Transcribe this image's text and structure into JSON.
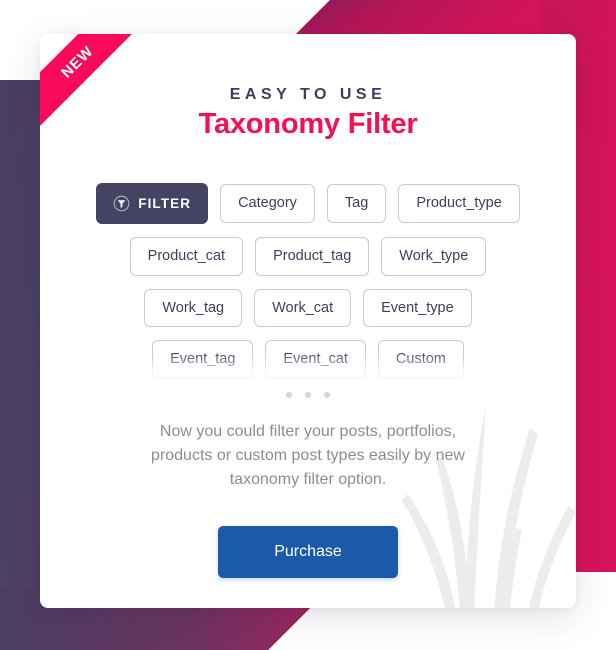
{
  "card": {
    "ribbon_label": "NEW",
    "eyebrow": "EASY TO USE",
    "title": "Taxonomy Filter",
    "description": "Now you could filter your posts, portfolios, products or custom post types easily by new taxonomy filter option.",
    "purchase_label": "Purchase"
  },
  "filter_button": {
    "label": "FILTER",
    "icon": "funnel-icon"
  },
  "tag_rows": [
    [
      "Category",
      "Tag",
      "Product_type"
    ],
    [
      "Product_cat",
      "Product_tag",
      "Work_type"
    ],
    [
      "Work_tag",
      "Work_cat",
      "Event_type"
    ],
    [
      "Event_tag",
      "Event_cat",
      "Custom"
    ]
  ],
  "pager_dots": 3,
  "colors": {
    "accent_pink": "#f5104f",
    "ribbon_pink": "#fa0a5a",
    "dark_purple": "#454364",
    "left_band": "#4a3f63",
    "magenta": "#cf1457",
    "purchase_blue": "#1a5aa8",
    "tag_border": "#c9c8da",
    "body_text": "#8c8c96"
  }
}
